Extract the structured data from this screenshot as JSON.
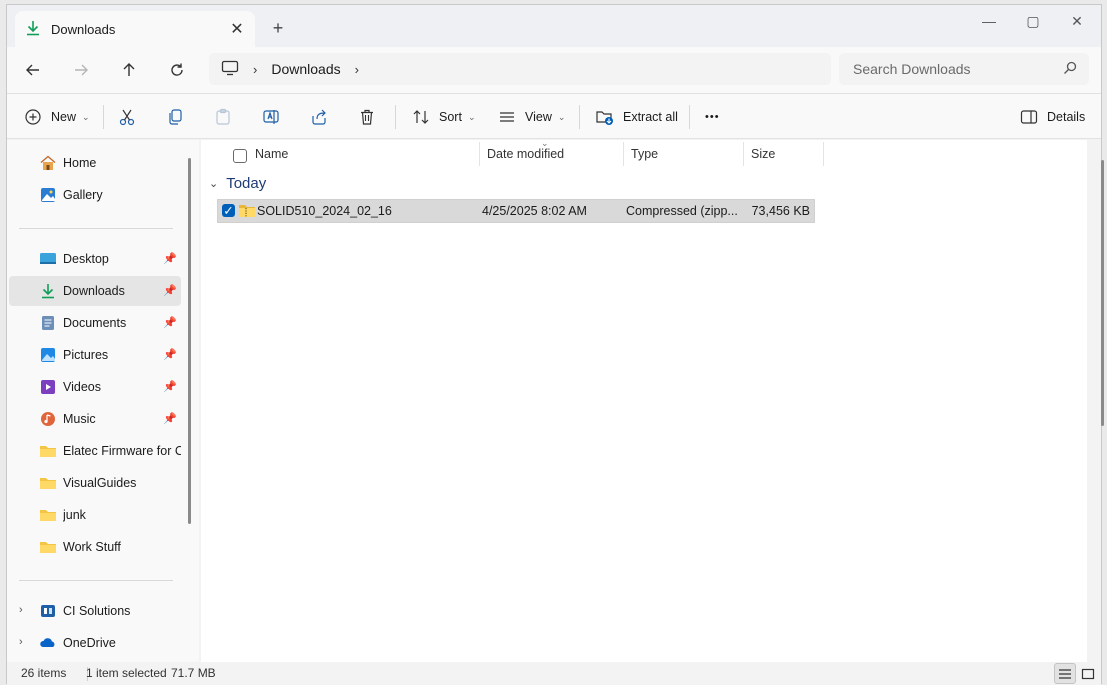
{
  "tab": {
    "title": "Downloads",
    "close": "✕",
    "new": "+"
  },
  "window_controls": {
    "minimize": "—",
    "maximize": "▢",
    "close": "✕"
  },
  "address": {
    "crumb": "Downloads",
    "separator": "›"
  },
  "search": {
    "placeholder": "Search Downloads"
  },
  "commands": {
    "new": "New",
    "sort": "Sort",
    "view": "View",
    "extract_all": "Extract all",
    "more": "•••",
    "details": "Details"
  },
  "nav": {
    "top": [
      {
        "label": "Home",
        "icon": "home-icon"
      },
      {
        "label": "Gallery",
        "icon": "gallery-icon"
      }
    ],
    "quick": [
      {
        "label": "Desktop",
        "icon": "desktop-icon",
        "pinned": true
      },
      {
        "label": "Downloads",
        "icon": "downloads-icon",
        "pinned": true,
        "selected": true
      },
      {
        "label": "Documents",
        "icon": "documents-icon",
        "pinned": true
      },
      {
        "label": "Pictures",
        "icon": "pictures-icon",
        "pinned": true
      },
      {
        "label": "Videos",
        "icon": "videos-icon",
        "pinned": true
      },
      {
        "label": "Music",
        "icon": "music-icon",
        "pinned": true
      },
      {
        "label": "Elatec Firmware for CI V",
        "icon": "folder-icon"
      },
      {
        "label": "VisualGuides",
        "icon": "folder-icon"
      },
      {
        "label": "junk",
        "icon": "folder-icon"
      },
      {
        "label": "Work Stuff",
        "icon": "folder-icon"
      }
    ],
    "bottom": [
      {
        "label": "CI Solutions",
        "icon": "ci-solutions-icon"
      },
      {
        "label": "OneDrive",
        "icon": "onedrive-icon"
      }
    ]
  },
  "columns": {
    "name": "Name",
    "date": "Date modified",
    "type": "Type",
    "size": "Size"
  },
  "group": {
    "label": "Today"
  },
  "files": [
    {
      "name": "SOLID510_2024_02_16",
      "date": "4/25/2025 8:02 AM",
      "type": "Compressed (zipp...",
      "size": "73,456 KB",
      "selected": true
    }
  ],
  "status": {
    "items": "26 items",
    "selected": "1 item selected",
    "size": "71.7 MB"
  },
  "colors": {
    "accent": "#005fb8",
    "folder": "#f4c542",
    "downloads": "#0f9d58"
  }
}
